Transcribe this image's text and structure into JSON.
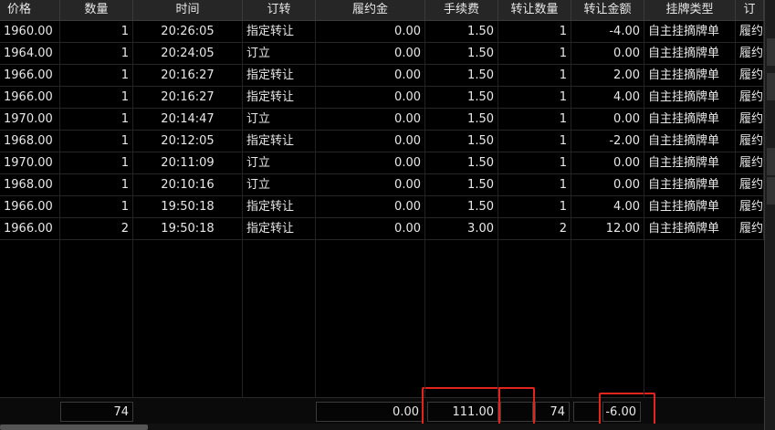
{
  "columns": [
    {
      "label": "价格"
    },
    {
      "label": "数量"
    },
    {
      "label": "时间"
    },
    {
      "label": "订转"
    },
    {
      "label": "履约金"
    },
    {
      "label": "手续费"
    },
    {
      "label": "转让数量"
    },
    {
      "label": "转让金额"
    },
    {
      "label": "挂牌类型"
    },
    {
      "label": "订"
    }
  ],
  "rows": [
    [
      "1960.00",
      "1",
      "20:26:05",
      "指定转让",
      "0.00",
      "1.50",
      "1",
      "-4.00",
      "自主挂摘牌单",
      "履约"
    ],
    [
      "1964.00",
      "1",
      "20:24:05",
      "订立",
      "0.00",
      "1.50",
      "1",
      "0.00",
      "自主挂摘牌单",
      "履约"
    ],
    [
      "1966.00",
      "1",
      "20:16:27",
      "指定转让",
      "0.00",
      "1.50",
      "1",
      "2.00",
      "自主挂摘牌单",
      "履约"
    ],
    [
      "1966.00",
      "1",
      "20:16:27",
      "指定转让",
      "0.00",
      "1.50",
      "1",
      "4.00",
      "自主挂摘牌单",
      "履约"
    ],
    [
      "1970.00",
      "1",
      "20:14:47",
      "订立",
      "0.00",
      "1.50",
      "1",
      "0.00",
      "自主挂摘牌单",
      "履约"
    ],
    [
      "1968.00",
      "1",
      "20:12:05",
      "指定转让",
      "0.00",
      "1.50",
      "1",
      "-2.00",
      "自主挂摘牌单",
      "履约"
    ],
    [
      "1970.00",
      "1",
      "20:11:09",
      "订立",
      "0.00",
      "1.50",
      "1",
      "0.00",
      "自主挂摘牌单",
      "履约"
    ],
    [
      "1968.00",
      "1",
      "20:10:16",
      "订立",
      "0.00",
      "1.50",
      "1",
      "0.00",
      "自主挂摘牌单",
      "履约"
    ],
    [
      "1966.00",
      "1",
      "19:50:18",
      "指定转让",
      "0.00",
      "1.50",
      "1",
      "4.00",
      "自主挂摘牌单",
      "履约"
    ],
    [
      "1966.00",
      "2",
      "19:50:18",
      "指定转让",
      "0.00",
      "3.00",
      "2",
      "12.00",
      "自主挂摘牌单",
      "履约"
    ]
  ],
  "totals": {
    "quantity": "74",
    "margin": "0.00",
    "fee": "111.00",
    "transfer_qty": "74",
    "transfer_amount": "-6.00"
  },
  "colors": {
    "highlight": "#e2241f",
    "background": "#000000",
    "header_bg": "#262626"
  }
}
